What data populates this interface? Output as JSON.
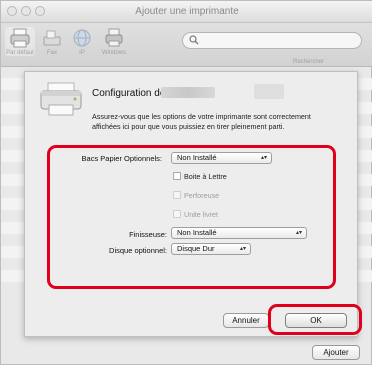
{
  "window": {
    "title": "Ajouter une imprimante"
  },
  "toolbar": {
    "items": [
      {
        "label": "Par défaut",
        "icon": "printer-icon"
      },
      {
        "label": "Fax",
        "icon": "fax-icon"
      },
      {
        "label": "IP",
        "icon": "globe-icon"
      },
      {
        "label": "Windows",
        "icon": "windows-printer-icon"
      }
    ],
    "search_placeholder": "",
    "search_label": "Rechercher"
  },
  "sheet": {
    "title": "Configuration de",
    "description": "Assurez-vous que les options de votre imprimante sont correctement affichées ici pour que vous puissiez en tirer pleinement parti.",
    "options": {
      "bacs_label": "Bacs Papier Optionnels:",
      "bacs_value": "Non Installé",
      "boite_label": "Boite à Lettre",
      "perforeuse_label": "Perforeuse",
      "unite_livret_label": "Unite livret",
      "finisseuse_label": "Finisseuse:",
      "finisseuse_value": "Non Installé",
      "disque_label": "Disque optionnel:",
      "disque_value": "Disque Dur"
    },
    "buttons": {
      "cancel": "Annuler",
      "ok": "OK"
    }
  },
  "footer": {
    "add_button": "Ajouter"
  },
  "colors": {
    "highlight": "#e0001b"
  }
}
